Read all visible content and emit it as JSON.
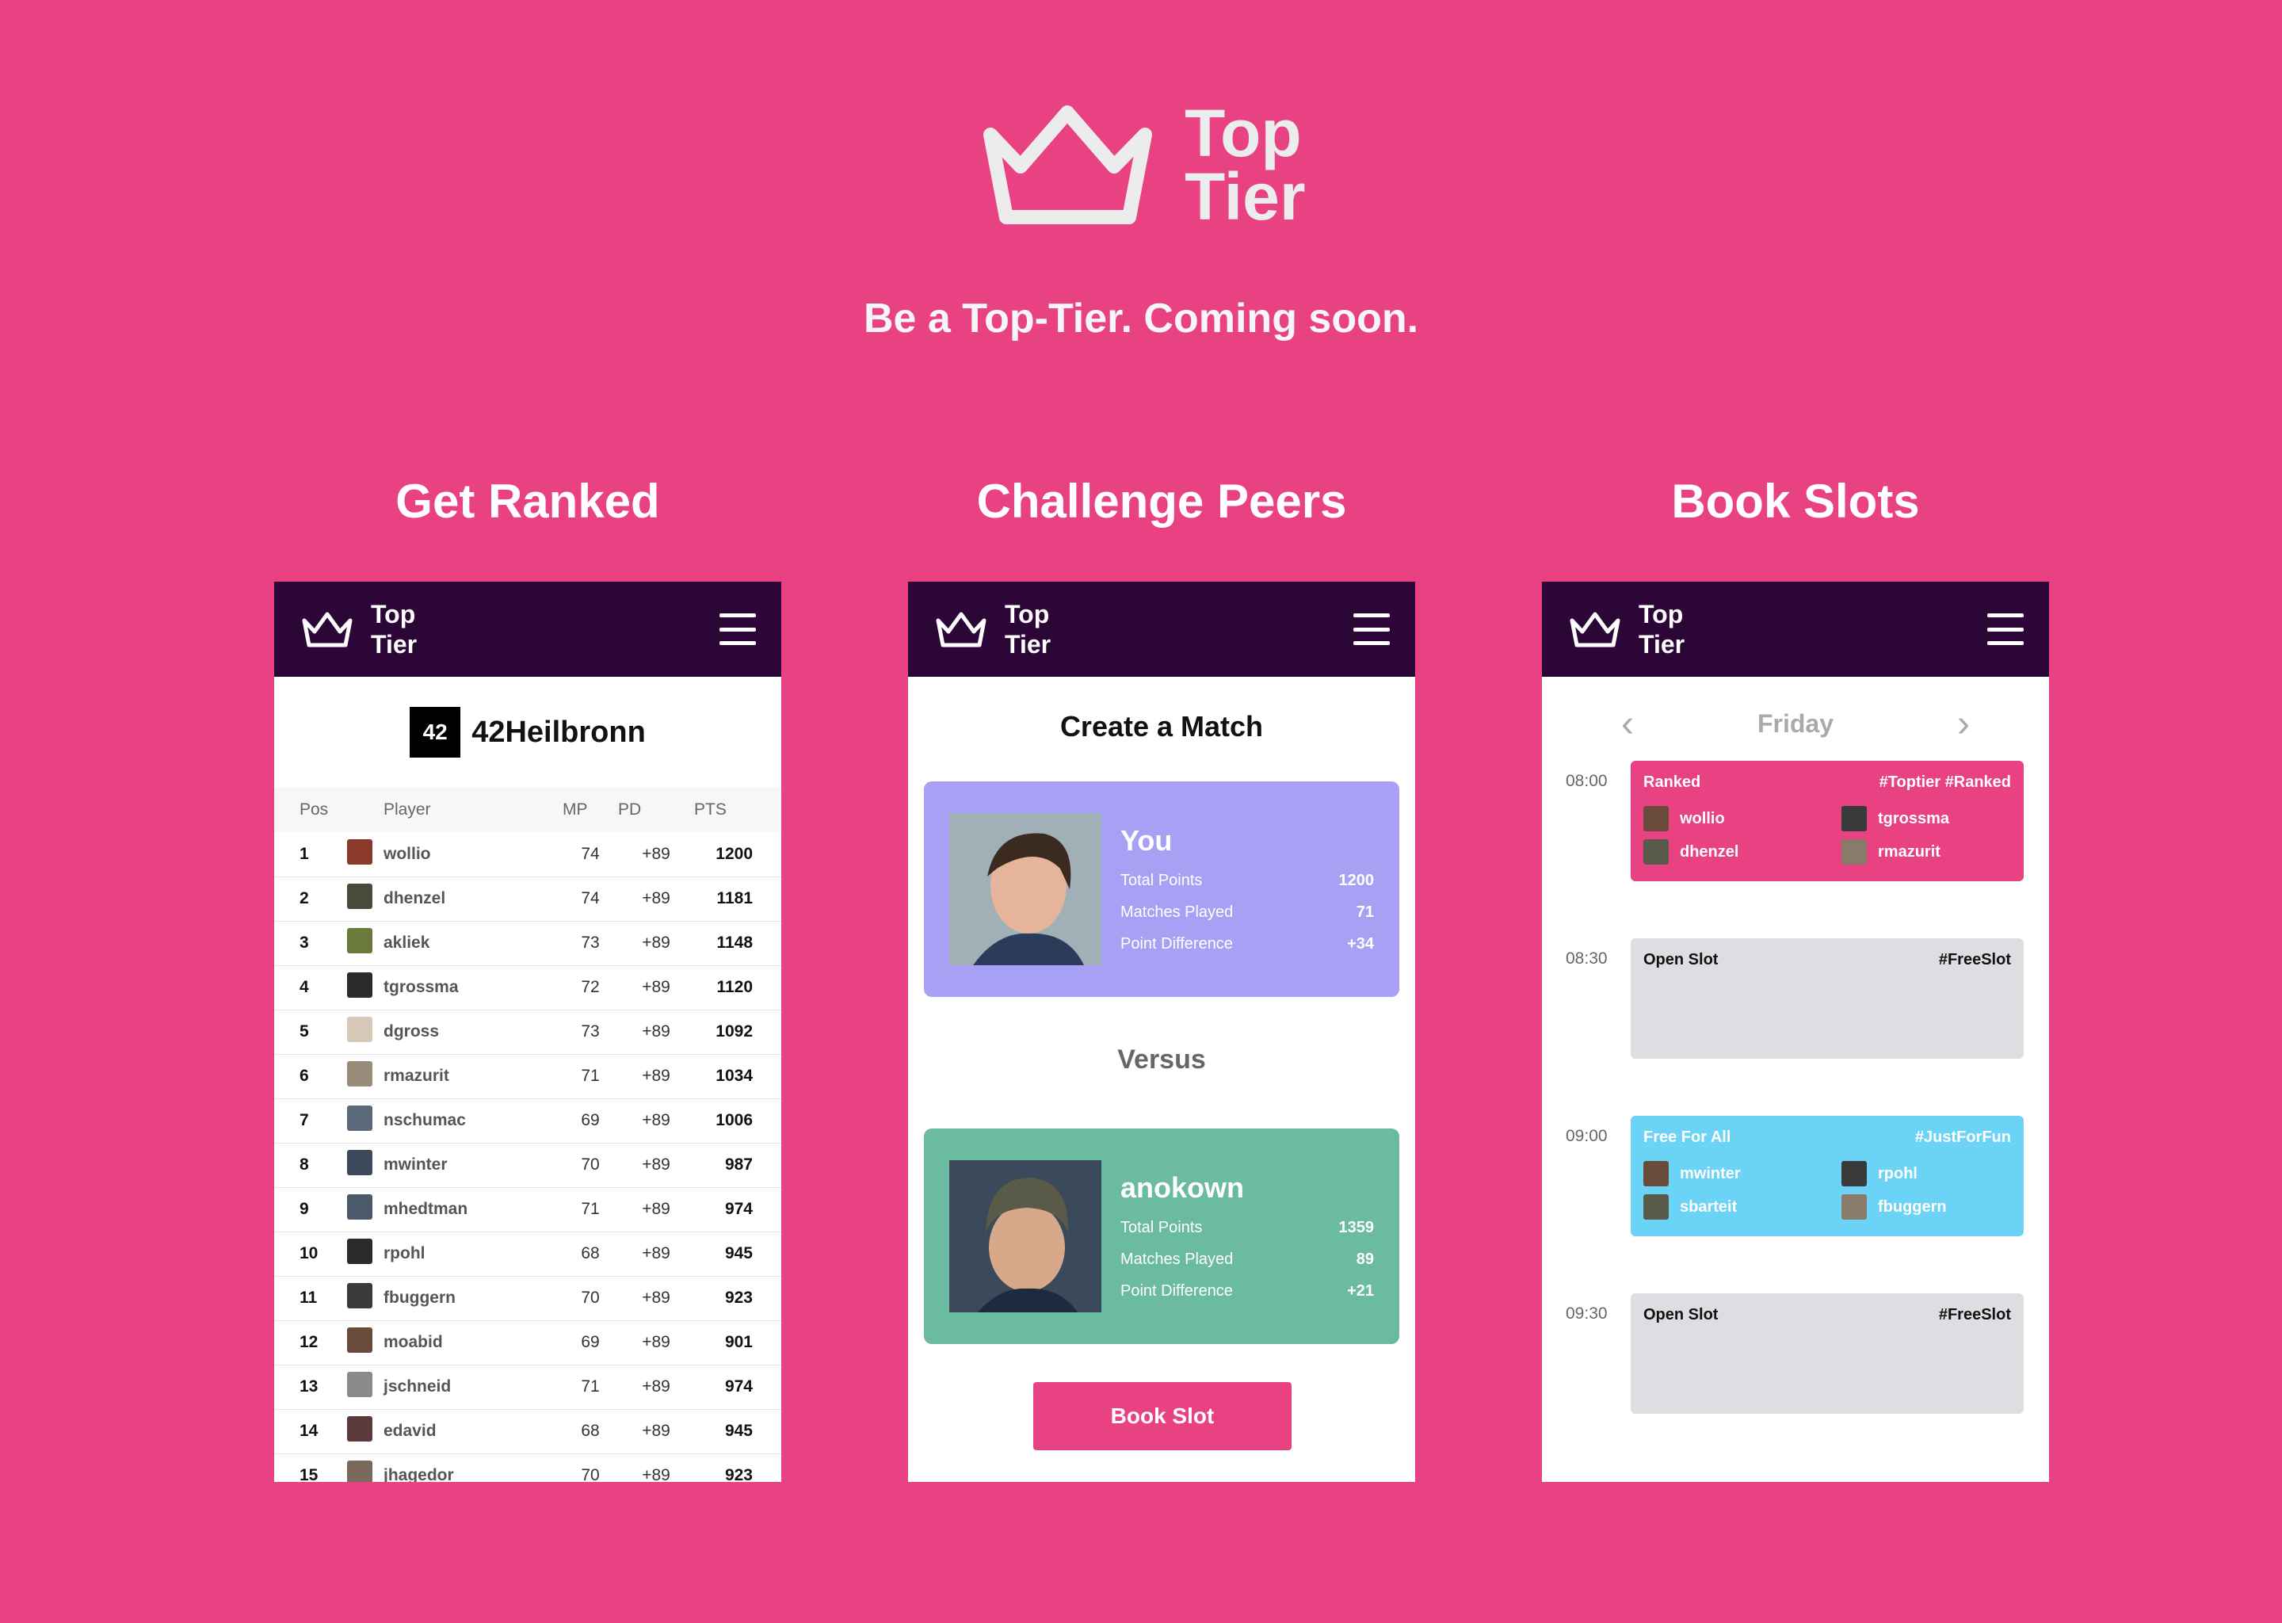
{
  "hero": {
    "brand_line1": "Top",
    "brand_line2": "Tier",
    "tagline": "Be a Top-Tier. Coming soon."
  },
  "sections": {
    "ranked_title": "Get Ranked",
    "challenge_title": "Challenge Peers",
    "slots_title": "Book Slots"
  },
  "app_header": {
    "line1": "Top",
    "line2": "Tier",
    "menu_icon": "hamburger-icon",
    "logo_icon": "crown-icon"
  },
  "ranking": {
    "club_logo": "42",
    "club_name": "42Heilbronn",
    "columns": [
      "Pos",
      "Player",
      "MP",
      "PD",
      "PTS"
    ],
    "rows": [
      {
        "pos": "1",
        "player": "wollio",
        "mp": "74",
        "pd": "+89",
        "pts": "1200",
        "color": "#8a3a2a"
      },
      {
        "pos": "2",
        "player": "dhenzel",
        "mp": "74",
        "pd": "+89",
        "pts": "1181",
        "color": "#4a4a3a"
      },
      {
        "pos": "3",
        "player": "akliek",
        "mp": "73",
        "pd": "+89",
        "pts": "1148",
        "color": "#6a7a3a"
      },
      {
        "pos": "4",
        "player": "tgrossma",
        "mp": "72",
        "pd": "+89",
        "pts": "1120",
        "color": "#2a2a2a"
      },
      {
        "pos": "5",
        "player": "dgross",
        "mp": "73",
        "pd": "+89",
        "pts": "1092",
        "color": "#d8c8b8"
      },
      {
        "pos": "6",
        "player": "rmazurit",
        "mp": "71",
        "pd": "+89",
        "pts": "1034",
        "color": "#9a8a7a"
      },
      {
        "pos": "7",
        "player": "nschumac",
        "mp": "69",
        "pd": "+89",
        "pts": "1006",
        "color": "#5a6a7a"
      },
      {
        "pos": "8",
        "player": "mwinter",
        "mp": "70",
        "pd": "+89",
        "pts": "987",
        "color": "#3a4a5a"
      },
      {
        "pos": "9",
        "player": "mhedtman",
        "mp": "71",
        "pd": "+89",
        "pts": "974",
        "color": "#4a5a6a"
      },
      {
        "pos": "10",
        "player": "rpohl",
        "mp": "68",
        "pd": "+89",
        "pts": "945",
        "color": "#2a2a2a"
      },
      {
        "pos": "11",
        "player": "fbuggern",
        "mp": "70",
        "pd": "+89",
        "pts": "923",
        "color": "#3a3a3a"
      },
      {
        "pos": "12",
        "player": "moabid",
        "mp": "69",
        "pd": "+89",
        "pts": "901",
        "color": "#6a4a3a"
      },
      {
        "pos": "13",
        "player": "jschneid",
        "mp": "71",
        "pd": "+89",
        "pts": "974",
        "color": "#8a8a8a"
      },
      {
        "pos": "14",
        "player": "edavid",
        "mp": "68",
        "pd": "+89",
        "pts": "945",
        "color": "#5a3a3a"
      },
      {
        "pos": "15",
        "player": "jhagedor",
        "mp": "70",
        "pd": "+89",
        "pts": "923",
        "color": "#7a6a5a"
      }
    ]
  },
  "match": {
    "title": "Create a Match",
    "versus": "Versus",
    "button": "Book Slot",
    "you": {
      "name": "You",
      "color": "#a8a0f4",
      "stats": [
        {
          "label": "Total Points",
          "value": "1200"
        },
        {
          "label": "Matches Played",
          "value": "71"
        },
        {
          "label": "Point Difference",
          "value": "+34"
        }
      ]
    },
    "opponent": {
      "name": "anokown",
      "color": "#6bbba0",
      "stats": [
        {
          "label": "Total Points",
          "value": "1359"
        },
        {
          "label": "Matches Played",
          "value": "89"
        },
        {
          "label": "Point Difference",
          "value": "+21"
        }
      ]
    }
  },
  "slots": {
    "day": "Friday",
    "items": [
      {
        "time": "08:00",
        "type": "Ranked",
        "tag": "#Toptier #Ranked",
        "color": "#e84282",
        "text_color": "#ffffff",
        "members": [
          "wollio",
          "tgrossma",
          "dhenzel",
          "rmazurit"
        ]
      },
      {
        "time": "08:30",
        "type": "Open Slot",
        "tag": "#FreeSlot",
        "color": "#e0dde2",
        "text_color": "#111111",
        "members": []
      },
      {
        "time": "09:00",
        "type": "Free For All",
        "tag": "#JustForFun",
        "color": "#6bd4f6",
        "text_color": "#ffffff",
        "members": [
          "mwinter",
          "rpohl",
          "sbarteit",
          "fbuggern"
        ]
      },
      {
        "time": "09:30",
        "type": "Open Slot",
        "tag": "#FreeSlot",
        "color": "#e0dde2",
        "text_color": "#111111",
        "members": []
      }
    ]
  }
}
